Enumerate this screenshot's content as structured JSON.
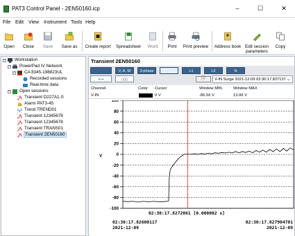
{
  "window": {
    "title": "PAT3 Control Panel - 2EN50160.icp",
    "min": "–",
    "max": "☐",
    "close": "✕"
  },
  "menu": [
    "File",
    "Edit",
    "View",
    "Instrument",
    "Tools",
    "Help"
  ],
  "toolbar": {
    "open": "Open",
    "close": "Close",
    "save": "Save",
    "save_as": "Save as",
    "create_report": "Create report",
    "spreadsheet": "Spreadsheet",
    "word": "Word",
    "print": "Print",
    "print_preview": "Print preview",
    "address_book": "Address book",
    "edit_session_parameters": "Edit session parameters",
    "copy": "Copy"
  },
  "tree": {
    "workstation": "Workstation",
    "network": "PowerPad IV Network",
    "device": "CA 8345-198823UL",
    "recorded": "Recorded sessions",
    "realtime": "Real-time data",
    "open_sessions": "Open sessions",
    "sessions": [
      "Transient D227A1-S",
      "Alarm PAT3-45",
      "Trend TREND01",
      "Transient 12345678",
      "Transient 12345678",
      "Transient TRANS01",
      "Transient 2EN50160"
    ]
  },
  "panel": {
    "title": "Transient 2EN50160",
    "buttons": [
      "",
      "V, A, W",
      "3-phase",
      "",
      "L1",
      "L2",
      "N"
    ],
    "dropdown": "V-IN Surge 2021-12-09 02:30:17.827137",
    "info": "ⓘ",
    "table": {
      "headers": {
        "channel": "Channel",
        "color": "Color",
        "cursor": "Cursor",
        "wmin": "Window MIN",
        "wmax": "Window MAX"
      },
      "row": {
        "channel": "V-IN",
        "cursor": "0 V",
        "wmin": "-86.56 V",
        "wmax": "13.06 V"
      }
    }
  },
  "chart_data": {
    "type": "line",
    "ylabel": "V",
    "ylim": [
      -100,
      100
    ],
    "yticks": [
      100,
      80,
      60,
      40,
      20,
      0,
      -20,
      -40,
      -60,
      -80,
      -100
    ],
    "cursor_label": "02:30:17.8272061 [0.000002 s]",
    "start_time": "02:30:17.82600117",
    "start_date": "2021-12-09",
    "end_time": "02:30:17.827904701",
    "end_date": "2021-12-09",
    "series": [
      {
        "color": "#000000",
        "values": [
          [
            0.0,
            -87.0
          ],
          [
            0.03,
            -87.5
          ],
          [
            0.06,
            -87.0
          ],
          [
            0.09,
            -88.5
          ],
          [
            0.12,
            -87.0
          ],
          [
            0.15,
            -88.0
          ],
          [
            0.18,
            -87.0
          ],
          [
            0.21,
            -88.0
          ],
          [
            0.24,
            -87.5
          ],
          [
            0.26,
            -87.0
          ],
          [
            0.268,
            -86.0
          ],
          [
            0.272,
            -42.0
          ],
          [
            0.278,
            -28.0
          ],
          [
            0.29,
            -22.0
          ],
          [
            0.3,
            -18.0
          ],
          [
            0.32,
            -10.0
          ],
          [
            0.335,
            -5.0
          ],
          [
            0.35,
            -2.0
          ],
          [
            0.36,
            0.0
          ],
          [
            0.38,
            0.5
          ],
          [
            0.4,
            0.0
          ],
          [
            0.42,
            1.0
          ],
          [
            0.44,
            0.0
          ],
          [
            0.46,
            1.5
          ],
          [
            0.48,
            0.5
          ],
          [
            0.5,
            2.0
          ],
          [
            0.52,
            1.0
          ],
          [
            0.54,
            3.0
          ],
          [
            0.56,
            2.0
          ],
          [
            0.58,
            3.5
          ],
          [
            0.6,
            2.5
          ],
          [
            0.62,
            4.0
          ],
          [
            0.64,
            2.5
          ],
          [
            0.66,
            5.0
          ],
          [
            0.68,
            3.0
          ],
          [
            0.7,
            5.0
          ],
          [
            0.72,
            3.5
          ],
          [
            0.74,
            6.0
          ],
          [
            0.76,
            3.0
          ],
          [
            0.78,
            7.0
          ],
          [
            0.8,
            4.0
          ],
          [
            0.82,
            8.0
          ],
          [
            0.84,
            4.0
          ],
          [
            0.86,
            9.0
          ],
          [
            0.88,
            5.0
          ],
          [
            0.9,
            10.0
          ],
          [
            0.92,
            5.0
          ],
          [
            0.94,
            11.0
          ],
          [
            0.96,
            6.0
          ],
          [
            0.98,
            12.0
          ],
          [
            1.0,
            8.0
          ]
        ]
      }
    ]
  },
  "colors": {
    "selection": "#cde4f7",
    "cursor": "#e8413d",
    "band": "#e4e6ea"
  }
}
